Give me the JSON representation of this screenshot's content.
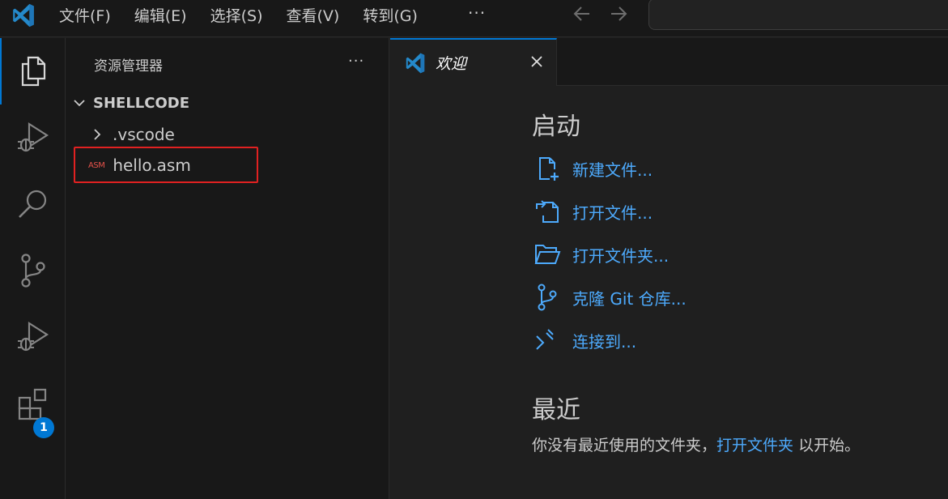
{
  "menu": {
    "items": [
      "文件(F)",
      "编辑(E)",
      "选择(S)",
      "查看(V)",
      "转到(G)"
    ],
    "more": "···"
  },
  "activity_bar": {
    "items": [
      "files-icon",
      "run-debug-icon",
      "search-icon",
      "source-control-icon",
      "run-debug-icon",
      "extensions-icon"
    ],
    "extensions_badge": "1",
    "accent": "#0078d4"
  },
  "sidebar": {
    "title": "资源管理器",
    "more": "···",
    "folder": "SHELLCODE",
    "items": [
      {
        "label": ".vscode",
        "type": "folder"
      },
      {
        "label": "hello.asm",
        "type": "file",
        "icon_text": "ASM"
      }
    ]
  },
  "editor": {
    "tab_label": "欢迎",
    "start_title": "启动",
    "actions": [
      {
        "label": "新建文件...",
        "icon": "new-file-icon"
      },
      {
        "label": "打开文件...",
        "icon": "open-file-icon"
      },
      {
        "label": "打开文件夹...",
        "icon": "open-folder-icon"
      },
      {
        "label": "克隆 Git 仓库...",
        "icon": "git-clone-icon"
      },
      {
        "label": "连接到...",
        "icon": "remote-connect-icon"
      }
    ],
    "recent_title": "最近",
    "recent_prefix": "你没有最近使用的文件夹，",
    "recent_link": "打开文件夹",
    "recent_suffix": " 以开始。",
    "link_color": "#4daafc"
  }
}
